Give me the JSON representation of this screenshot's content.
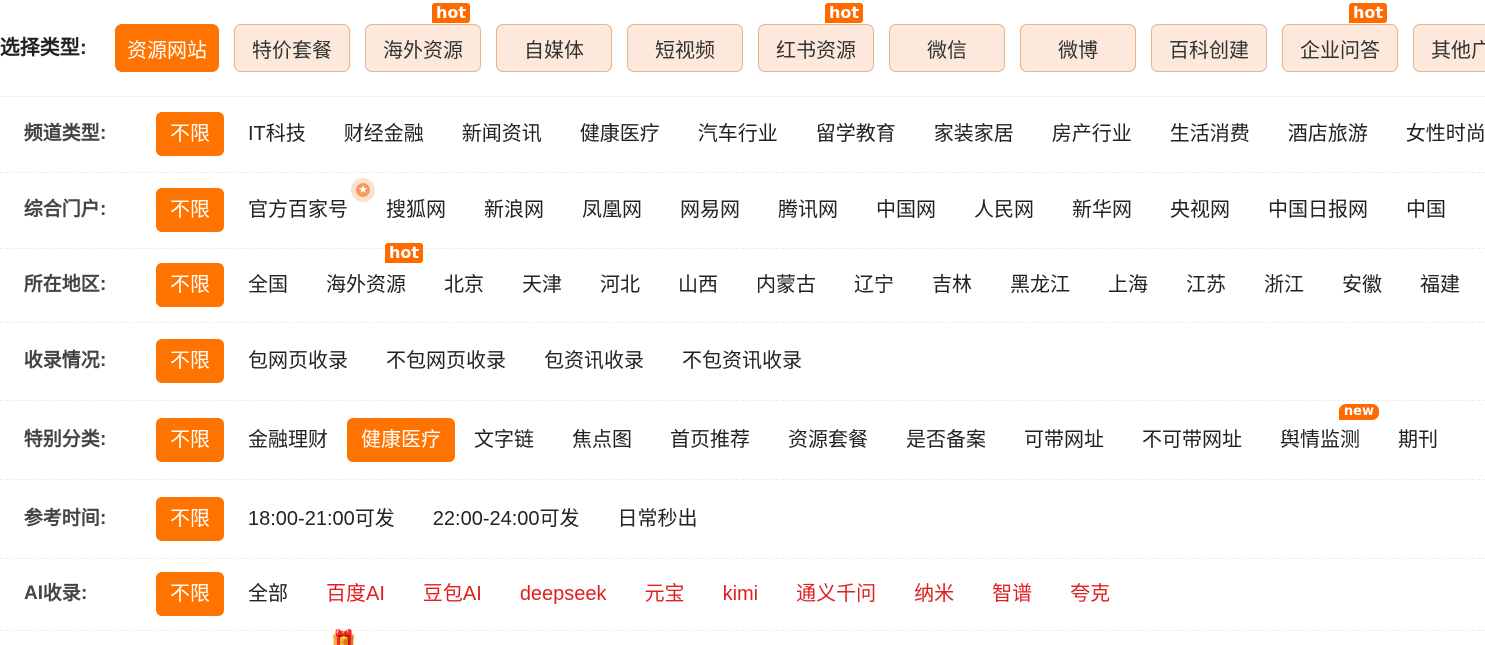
{
  "type_bar": {
    "label": "选择类型:",
    "buttons": [
      {
        "label": "资源网站",
        "active": true,
        "badge": ""
      },
      {
        "label": "特价套餐",
        "badge": ""
      },
      {
        "label": "海外资源",
        "badge": "hot"
      },
      {
        "label": "自媒体",
        "badge": ""
      },
      {
        "label": "短视频",
        "badge": ""
      },
      {
        "label": "红书资源",
        "badge": "hot"
      },
      {
        "label": "微信",
        "badge": ""
      },
      {
        "label": "微博",
        "badge": ""
      },
      {
        "label": "百科创建",
        "badge": ""
      },
      {
        "label": "企业问答",
        "badge": "hot"
      },
      {
        "label": "其他广告",
        "badge": ""
      }
    ]
  },
  "rows": [
    {
      "key": "channel",
      "label": "频道类型:",
      "options": [
        {
          "text": "不限",
          "kind": "unlimited"
        },
        {
          "text": "IT科技"
        },
        {
          "text": "财经金融"
        },
        {
          "text": "新闻资讯"
        },
        {
          "text": "健康医疗"
        },
        {
          "text": "汽车行业"
        },
        {
          "text": "留学教育"
        },
        {
          "text": "家装家居"
        },
        {
          "text": "房产行业"
        },
        {
          "text": "生活消费"
        },
        {
          "text": "酒店旅游"
        },
        {
          "text": "女性时尚"
        }
      ]
    },
    {
      "key": "portal",
      "label": "综合门户:",
      "options": [
        {
          "text": "不限",
          "kind": "unlimited"
        },
        {
          "text": "官方百家号",
          "icon": "star-medal-icon"
        },
        {
          "text": "搜狐网"
        },
        {
          "text": "新浪网"
        },
        {
          "text": "凤凰网"
        },
        {
          "text": "网易网"
        },
        {
          "text": "腾讯网"
        },
        {
          "text": "中国网"
        },
        {
          "text": "人民网"
        },
        {
          "text": "新华网"
        },
        {
          "text": "央视网"
        },
        {
          "text": "中国日报网"
        },
        {
          "text": "中国"
        }
      ]
    },
    {
      "key": "region",
      "label": "所在地区:",
      "options": [
        {
          "text": "不限",
          "kind": "unlimited"
        },
        {
          "text": "全国"
        },
        {
          "text": "海外资源",
          "badge": "hot"
        },
        {
          "text": "北京"
        },
        {
          "text": "天津"
        },
        {
          "text": "河北"
        },
        {
          "text": "山西"
        },
        {
          "text": "内蒙古"
        },
        {
          "text": "辽宁"
        },
        {
          "text": "吉林"
        },
        {
          "text": "黑龙江"
        },
        {
          "text": "上海"
        },
        {
          "text": "江苏"
        },
        {
          "text": "浙江"
        },
        {
          "text": "安徽"
        },
        {
          "text": "福建"
        }
      ]
    },
    {
      "key": "index",
      "label": "收录情况:",
      "options": [
        {
          "text": "不限",
          "kind": "unlimited"
        },
        {
          "text": "包网页收录"
        },
        {
          "text": "不包网页收录"
        },
        {
          "text": "包资讯收录"
        },
        {
          "text": "不包资讯收录"
        }
      ]
    },
    {
      "key": "special",
      "label": "特别分类:",
      "options": [
        {
          "text": "不限",
          "kind": "unlimited"
        },
        {
          "text": "金融理财"
        },
        {
          "text": "健康医疗",
          "kind": "selected"
        },
        {
          "text": "文字链"
        },
        {
          "text": "焦点图"
        },
        {
          "text": "首页推荐"
        },
        {
          "text": "资源套餐"
        },
        {
          "text": "是否备案"
        },
        {
          "text": "可带网址"
        },
        {
          "text": "不可带网址"
        },
        {
          "text": "舆情监测",
          "badge": "new"
        },
        {
          "text": "期刊"
        }
      ]
    },
    {
      "key": "time",
      "label": "参考时间:",
      "options": [
        {
          "text": "不限",
          "kind": "unlimited"
        },
        {
          "text": "18:00-21:00可发"
        },
        {
          "text": "22:00-24:00可发"
        },
        {
          "text": "日常秒出"
        }
      ]
    },
    {
      "key": "ai",
      "label": "AI收录:",
      "options": [
        {
          "text": "不限",
          "kind": "unlimited"
        },
        {
          "text": "全部"
        },
        {
          "text": "百度AI",
          "kind": "red"
        },
        {
          "text": "豆包AI",
          "kind": "red"
        },
        {
          "text": "deepseek",
          "kind": "red"
        },
        {
          "text": "元宝",
          "kind": "red"
        },
        {
          "text": "kimi",
          "kind": "red"
        },
        {
          "text": "通义千问",
          "kind": "red"
        },
        {
          "text": "纳米",
          "kind": "red"
        },
        {
          "text": "智谱",
          "kind": "red"
        },
        {
          "text": "夸克",
          "kind": "red"
        }
      ]
    }
  ],
  "colors": {
    "accent": "#ff7300",
    "chip_bg": "#fde9dc",
    "chip_border": "#e6b390",
    "badge": "#ff6a00",
    "ai_red": "#e02020"
  },
  "icons": {
    "footer": "gift-icon"
  }
}
